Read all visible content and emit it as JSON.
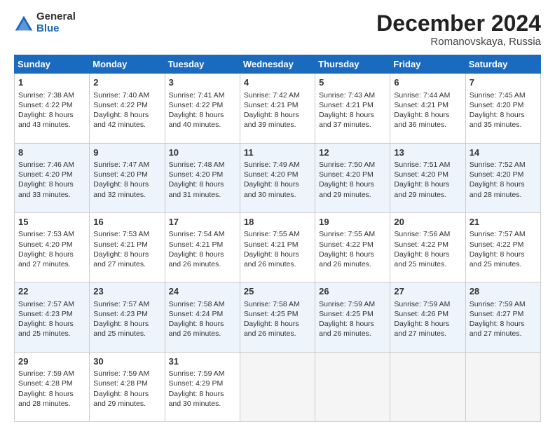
{
  "logo": {
    "general": "General",
    "blue": "Blue"
  },
  "header": {
    "month": "December 2024",
    "location": "Romanovskaya, Russia"
  },
  "weekdays": [
    "Sunday",
    "Monday",
    "Tuesday",
    "Wednesday",
    "Thursday",
    "Friday",
    "Saturday"
  ],
  "weeks": [
    [
      {
        "day": "1",
        "sun": "Sunrise: 7:38 AM",
        "set": "Sunset: 4:22 PM",
        "day_hours": "Daylight: 8 hours and 43 minutes."
      },
      {
        "day": "2",
        "sun": "Sunrise: 7:40 AM",
        "set": "Sunset: 4:22 PM",
        "day_hours": "Daylight: 8 hours and 42 minutes."
      },
      {
        "day": "3",
        "sun": "Sunrise: 7:41 AM",
        "set": "Sunset: 4:22 PM",
        "day_hours": "Daylight: 8 hours and 40 minutes."
      },
      {
        "day": "4",
        "sun": "Sunrise: 7:42 AM",
        "set": "Sunset: 4:21 PM",
        "day_hours": "Daylight: 8 hours and 39 minutes."
      },
      {
        "day": "5",
        "sun": "Sunrise: 7:43 AM",
        "set": "Sunset: 4:21 PM",
        "day_hours": "Daylight: 8 hours and 37 minutes."
      },
      {
        "day": "6",
        "sun": "Sunrise: 7:44 AM",
        "set": "Sunset: 4:21 PM",
        "day_hours": "Daylight: 8 hours and 36 minutes."
      },
      {
        "day": "7",
        "sun": "Sunrise: 7:45 AM",
        "set": "Sunset: 4:20 PM",
        "day_hours": "Daylight: 8 hours and 35 minutes."
      }
    ],
    [
      {
        "day": "8",
        "sun": "Sunrise: 7:46 AM",
        "set": "Sunset: 4:20 PM",
        "day_hours": "Daylight: 8 hours and 33 minutes."
      },
      {
        "day": "9",
        "sun": "Sunrise: 7:47 AM",
        "set": "Sunset: 4:20 PM",
        "day_hours": "Daylight: 8 hours and 32 minutes."
      },
      {
        "day": "10",
        "sun": "Sunrise: 7:48 AM",
        "set": "Sunset: 4:20 PM",
        "day_hours": "Daylight: 8 hours and 31 minutes."
      },
      {
        "day": "11",
        "sun": "Sunrise: 7:49 AM",
        "set": "Sunset: 4:20 PM",
        "day_hours": "Daylight: 8 hours and 30 minutes."
      },
      {
        "day": "12",
        "sun": "Sunrise: 7:50 AM",
        "set": "Sunset: 4:20 PM",
        "day_hours": "Daylight: 8 hours and 29 minutes."
      },
      {
        "day": "13",
        "sun": "Sunrise: 7:51 AM",
        "set": "Sunset: 4:20 PM",
        "day_hours": "Daylight: 8 hours and 29 minutes."
      },
      {
        "day": "14",
        "sun": "Sunrise: 7:52 AM",
        "set": "Sunset: 4:20 PM",
        "day_hours": "Daylight: 8 hours and 28 minutes."
      }
    ],
    [
      {
        "day": "15",
        "sun": "Sunrise: 7:53 AM",
        "set": "Sunset: 4:20 PM",
        "day_hours": "Daylight: 8 hours and 27 minutes."
      },
      {
        "day": "16",
        "sun": "Sunrise: 7:53 AM",
        "set": "Sunset: 4:21 PM",
        "day_hours": "Daylight: 8 hours and 27 minutes."
      },
      {
        "day": "17",
        "sun": "Sunrise: 7:54 AM",
        "set": "Sunset: 4:21 PM",
        "day_hours": "Daylight: 8 hours and 26 minutes."
      },
      {
        "day": "18",
        "sun": "Sunrise: 7:55 AM",
        "set": "Sunset: 4:21 PM",
        "day_hours": "Daylight: 8 hours and 26 minutes."
      },
      {
        "day": "19",
        "sun": "Sunrise: 7:55 AM",
        "set": "Sunset: 4:22 PM",
        "day_hours": "Daylight: 8 hours and 26 minutes."
      },
      {
        "day": "20",
        "sun": "Sunrise: 7:56 AM",
        "set": "Sunset: 4:22 PM",
        "day_hours": "Daylight: 8 hours and 25 minutes."
      },
      {
        "day": "21",
        "sun": "Sunrise: 7:57 AM",
        "set": "Sunset: 4:22 PM",
        "day_hours": "Daylight: 8 hours and 25 minutes."
      }
    ],
    [
      {
        "day": "22",
        "sun": "Sunrise: 7:57 AM",
        "set": "Sunset: 4:23 PM",
        "day_hours": "Daylight: 8 hours and 25 minutes."
      },
      {
        "day": "23",
        "sun": "Sunrise: 7:57 AM",
        "set": "Sunset: 4:23 PM",
        "day_hours": "Daylight: 8 hours and 25 minutes."
      },
      {
        "day": "24",
        "sun": "Sunrise: 7:58 AM",
        "set": "Sunset: 4:24 PM",
        "day_hours": "Daylight: 8 hours and 26 minutes."
      },
      {
        "day": "25",
        "sun": "Sunrise: 7:58 AM",
        "set": "Sunset: 4:25 PM",
        "day_hours": "Daylight: 8 hours and 26 minutes."
      },
      {
        "day": "26",
        "sun": "Sunrise: 7:59 AM",
        "set": "Sunset: 4:25 PM",
        "day_hours": "Daylight: 8 hours and 26 minutes."
      },
      {
        "day": "27",
        "sun": "Sunrise: 7:59 AM",
        "set": "Sunset: 4:26 PM",
        "day_hours": "Daylight: 8 hours and 27 minutes."
      },
      {
        "day": "28",
        "sun": "Sunrise: 7:59 AM",
        "set": "Sunset: 4:27 PM",
        "day_hours": "Daylight: 8 hours and 27 minutes."
      }
    ],
    [
      {
        "day": "29",
        "sun": "Sunrise: 7:59 AM",
        "set": "Sunset: 4:28 PM",
        "day_hours": "Daylight: 8 hours and 28 minutes."
      },
      {
        "day": "30",
        "sun": "Sunrise: 7:59 AM",
        "set": "Sunset: 4:28 PM",
        "day_hours": "Daylight: 8 hours and 29 minutes."
      },
      {
        "day": "31",
        "sun": "Sunrise: 7:59 AM",
        "set": "Sunset: 4:29 PM",
        "day_hours": "Daylight: 8 hours and 30 minutes."
      },
      null,
      null,
      null,
      null
    ]
  ]
}
